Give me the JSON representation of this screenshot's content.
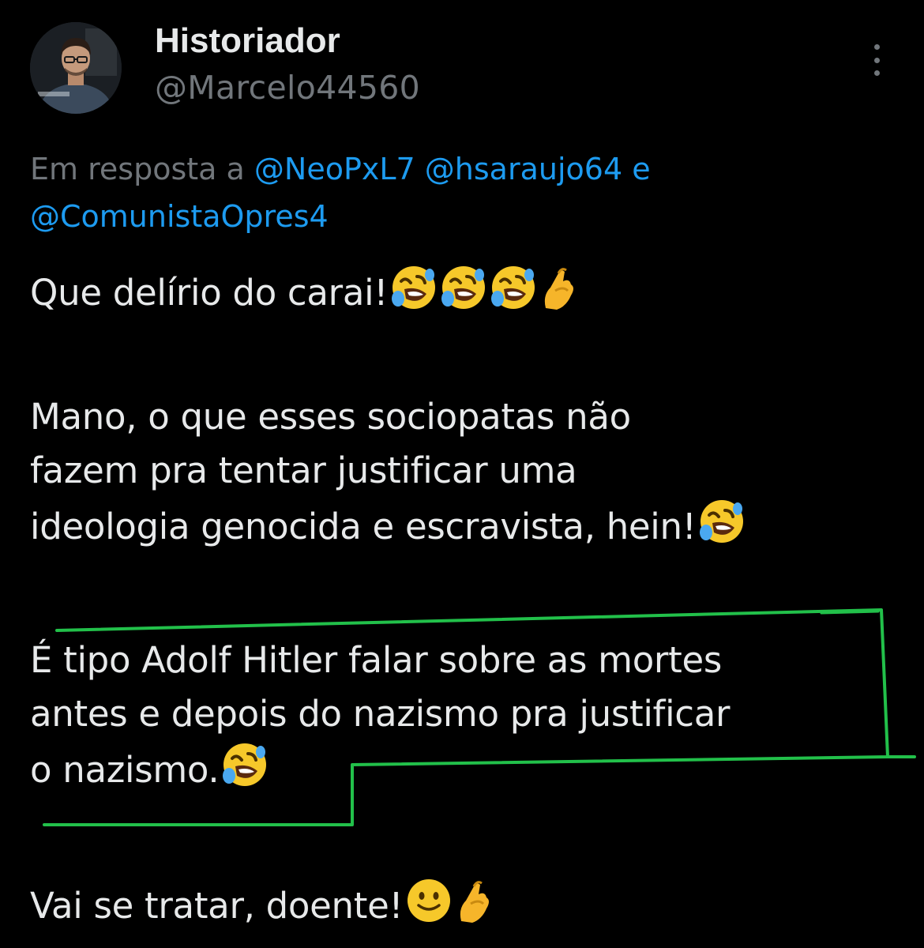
{
  "author": {
    "display_name": "Historiador",
    "handle": "@Marcelo44560"
  },
  "reply": {
    "prefix": "Em resposta a",
    "mentions": [
      "@NeoPxL7",
      "@hsaraujo64",
      "@ComunistaOpres4"
    ],
    "conjunction": "e"
  },
  "tweet": {
    "paragraphs": [
      {
        "text": "Que delírio do carai!",
        "emojis": [
          "rolling-on-floor-laughing",
          "rolling-on-floor-laughing",
          "rolling-on-floor-laughing",
          "pinched-fingers"
        ]
      },
      {
        "lines": [
          "Mano, o que esses sociopatas não",
          "fazem pra tentar justificar uma",
          "ideologia genocida e escravista, hein!"
        ],
        "emojis": [
          "rolling-on-floor-laughing"
        ]
      },
      {
        "lines": [
          "É tipo Adolf Hitler falar sobre as mortes",
          "antes e depois do nazismo pra justificar",
          "o nazismo."
        ],
        "emojis": [
          "rolling-on-floor-laughing"
        ]
      },
      {
        "text": "Vai se tratar, doente!",
        "emojis": [
          "slightly-smiling-face",
          "pinched-fingers"
        ]
      }
    ]
  },
  "colors": {
    "background": "#000000",
    "text": "#e7e9ea",
    "secondary": "#71767b",
    "link": "#1d9bf0",
    "highlight_outline": "#22c04a"
  },
  "icons": {
    "more": "more-vertical-icon",
    "avatar": "avatar-photo"
  }
}
